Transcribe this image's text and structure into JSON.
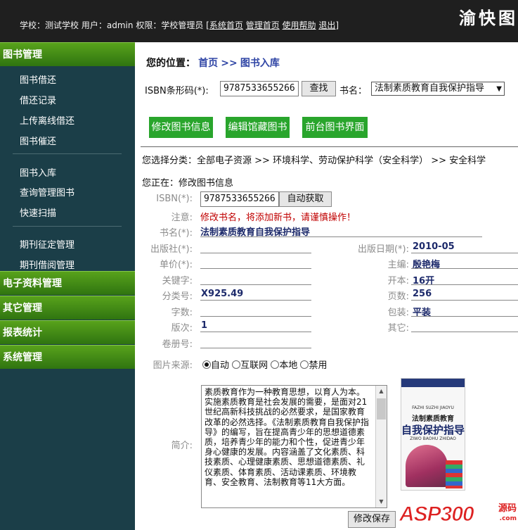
{
  "header": {
    "school_label": "学校：",
    "school": "测试学校",
    "user_label": "用户：",
    "user": "admin",
    "role_label": "权限：",
    "role": "学校管理员",
    "bracket_open": "[",
    "link_sys_home": "系统首页",
    "link_mgr_home": "管理首页",
    "link_help": "使用帮助",
    "link_logout": "退出",
    "bracket_close": "]",
    "brand": "渝快图"
  },
  "sidebar": {
    "sections": [
      "图书管理",
      "电子资料管理",
      "其它管理",
      "报表统计",
      "系统管理"
    ],
    "group1": [
      "图书借还",
      "借还记录",
      "上传离线借还",
      "图书催还"
    ],
    "group2": [
      "图书入库",
      "查询管理图书",
      "快速扫描"
    ],
    "group3": [
      "期刊征定管理",
      "期刊借阅管理"
    ]
  },
  "breadcrumb": {
    "label": "您的位置：",
    "home": "首页",
    "sep": ">>",
    "current": "图书入库"
  },
  "search": {
    "isbn_label": "ISBN条形码(*):",
    "isbn_value": "9787533655266",
    "search_button": "查找",
    "title_label": "书名：",
    "title_selected": "法制素质教育自我保护指导"
  },
  "actions": [
    "修改图书信息",
    "编辑馆藏图书",
    "前台图书界面"
  ],
  "category": {
    "label": "您选择分类：",
    "path": "全部电子资源 >> 环境科学、劳动保护科学（安全科学） >> 安全科学"
  },
  "status_line": "您正在：修改图书信息",
  "form": {
    "isbn_label": "ISBN(*):",
    "isbn_value": "9787533655266",
    "auto_button": "自动获取",
    "note_label": "注意:",
    "note_text": "修改书名，将添加新书，请谨慎操作！",
    "title_label": "书名(*):",
    "title_value": "法制素质教育自我保护指导",
    "publisher_label": "出版社(*):",
    "pubdate_label": "出版日期(*):",
    "pubdate_value": "2010-05",
    "price_label": "单价(*):",
    "editor_label": "主编:",
    "editor_value": "殷艳梅",
    "keywords_label": "关键字:",
    "format_label": "开本:",
    "format_value": "16开",
    "class_label": "分类号:",
    "class_value": "X925.49",
    "pages_label": "页数:",
    "pages_value": "256",
    "words_label": "字数:",
    "binding_label": "包装:",
    "binding_value": "平装",
    "edition_label": "版次:",
    "edition_value": "1",
    "other_label": "其它:",
    "volume_label": "卷册号:",
    "img_source_label": "图片来源:",
    "img_sources": [
      "自动",
      "互联网",
      "本地",
      "禁用"
    ],
    "img_source_selected": "自动",
    "intro_label": "简介:",
    "intro_text": "素质教育作为一种教育思想，以育人为本。实施素质教育是社会发展的需要，是面对21世纪高新科技挑战的必然要求，是国家教育改革的必然选择。《法制素质教育自我保护指导》的编写，旨在提高青少年的思想道德素质，培养青少年的能力和个性，促进青少年身心健康的发展。内容涵盖了文化素质、科技素质、心理健康素质、思想道德素质、礼仪素质、体育素质、活动课素质、环境教育、安全教育、法制教育等11大方面。",
    "save_button": "修改保存"
  },
  "cover": {
    "pinyin_top": "FAZHI SUZHI JIAOYU",
    "title_small": "法制素质教育",
    "title_big": "自我保护指导",
    "pinyin_bottom": "ZIWO BAOHU ZHIDAO"
  },
  "watermark": {
    "main": "ASP300",
    "side": "源码",
    "sub": ".com"
  },
  "colors": {
    "sidebar_bg": "#1b3e48",
    "section_green": "#3f8a15",
    "action_green": "#29a52c",
    "link_blue": "#2f45a5",
    "warn_red": "#c00000"
  }
}
